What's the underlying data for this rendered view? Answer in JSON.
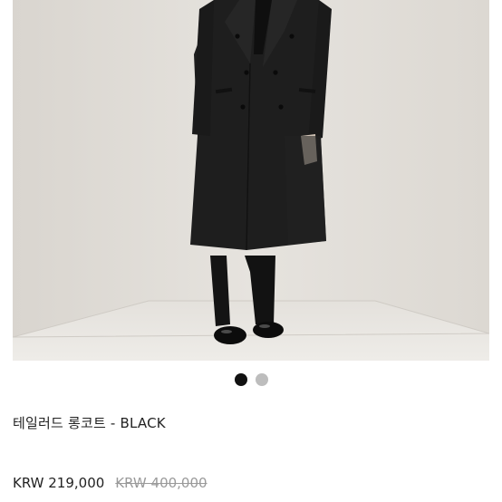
{
  "product": {
    "image_icon": "long-coat-photo",
    "title": "테일러드 롱코트 - BLACK",
    "price_current": "KRW 219,000",
    "price_original": "KRW 400,000"
  },
  "carousel": {
    "total": 2,
    "active_index": 1
  },
  "colors": {
    "active_dot": "#111111",
    "inactive_dot": "#bdbdbd"
  }
}
